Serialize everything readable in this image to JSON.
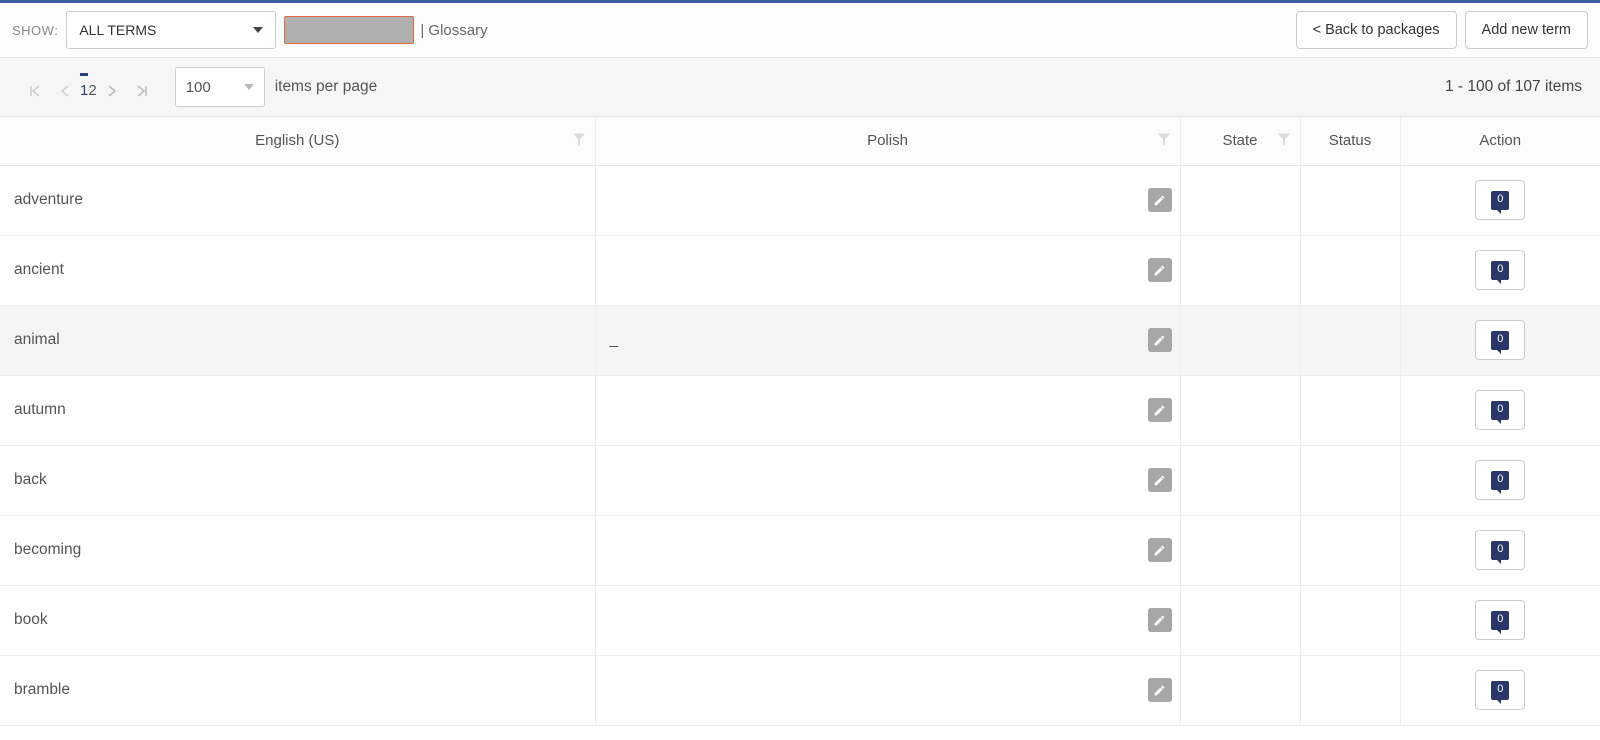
{
  "toolbar": {
    "show_label": "SHOW:",
    "filter_select_value": "ALL TERMS",
    "breadcrumb_sep": "| ",
    "breadcrumb_item": "Glossary",
    "back_button": "< Back to packages",
    "add_button": "Add new term"
  },
  "pager": {
    "pages": [
      "1",
      "2"
    ],
    "active_page": "1",
    "per_page_value": "100",
    "per_page_label": "items per page",
    "range_label": "1 - 100 of 107 items"
  },
  "columns": {
    "english": "English (US)",
    "polish": "Polish",
    "state": "State",
    "status": "Status",
    "action": "Action"
  },
  "rows": [
    {
      "english": "adventure",
      "polish": "",
      "hover": false,
      "comments": "0"
    },
    {
      "english": "ancient",
      "polish": "",
      "hover": false,
      "comments": "0"
    },
    {
      "english": "animal",
      "polish": "_",
      "hover": true,
      "comments": "0"
    },
    {
      "english": "autumn",
      "polish": "",
      "hover": false,
      "comments": "0"
    },
    {
      "english": "back",
      "polish": "",
      "hover": false,
      "comments": "0"
    },
    {
      "english": "becoming",
      "polish": "",
      "hover": false,
      "comments": "0"
    },
    {
      "english": "book",
      "polish": "",
      "hover": false,
      "comments": "0"
    },
    {
      "english": "bramble",
      "polish": "",
      "hover": false,
      "comments": "0"
    }
  ]
}
